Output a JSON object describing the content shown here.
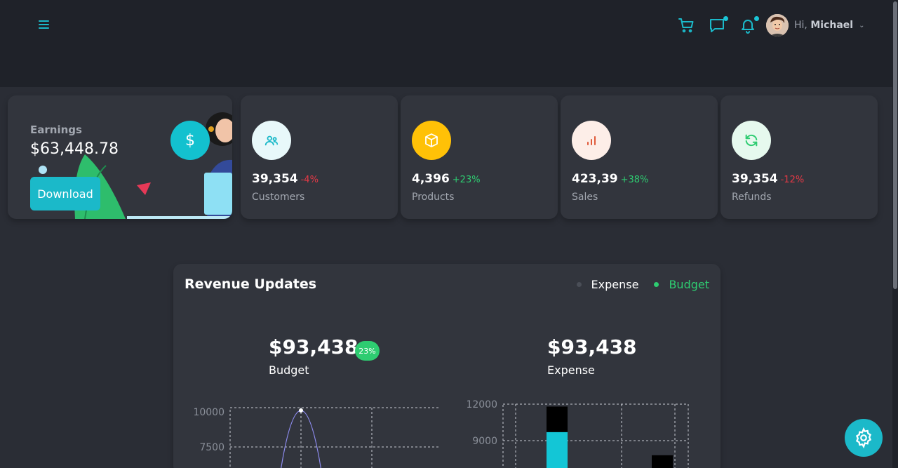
{
  "header": {
    "greeting": "Hi,",
    "user_name": "Michael",
    "icons": [
      "menu-icon",
      "cart-icon",
      "chat-icon",
      "bell-icon"
    ]
  },
  "earnings": {
    "label": "Earnings",
    "value": "$63,448.78",
    "button_label": "Download",
    "icon_glyph": "$"
  },
  "stats": [
    {
      "value": "39,354",
      "change": "-4%",
      "label": "Customers",
      "icon": "users-icon",
      "change_color": "#e63946",
      "icon_bg": "#e8f8fa",
      "icon_color": "#1bb9c9"
    },
    {
      "value": "4,396",
      "change": "+23%",
      "label": "Products",
      "icon": "box-icon",
      "change_color": "#2ecc71",
      "icon_bg": "#ffc107",
      "icon_color": "#ffffff"
    },
    {
      "value": "423,39",
      "change": "+38%",
      "label": "Sales",
      "icon": "bar-chart-icon",
      "change_color": "#2ecc71",
      "icon_bg": "#fdeee8",
      "icon_color": "#e05a3a"
    },
    {
      "value": "39,354",
      "change": "-12%",
      "label": "Refunds",
      "icon": "refresh-icon",
      "change_color": "#e63946",
      "icon_bg": "#e6f9ee",
      "icon_color": "#2ecc71"
    }
  ],
  "revenue": {
    "title": "Revenue Updates",
    "legend": [
      {
        "label": "Expense",
        "color": "#4a4e57",
        "text_color": "#ffffff"
      },
      {
        "label": "Budget",
        "color": "#2ecc71",
        "text_color": "#2ecc71"
      }
    ],
    "budget_value": "$93,438",
    "budget_label": "Budget",
    "budget_badge": "23%",
    "expense_value": "$93,438",
    "expense_label": "Expense"
  },
  "chart_data": [
    {
      "type": "line",
      "y_ticks": [
        "10000",
        "7500"
      ],
      "ylim": [
        5000,
        10000
      ],
      "peak_value": 10000,
      "grid": true
    },
    {
      "type": "bar",
      "y_ticks": [
        "12000",
        "9000"
      ],
      "ylim": [
        6000,
        12000
      ],
      "series": [
        {
          "values": [
            9700,
            null
          ]
        },
        {
          "values": [
            11800,
            7800
          ]
        }
      ],
      "grid": true
    }
  ],
  "colors": {
    "accent": "#1bb9c9",
    "background": "#2a2d35",
    "card": "#32353d"
  }
}
